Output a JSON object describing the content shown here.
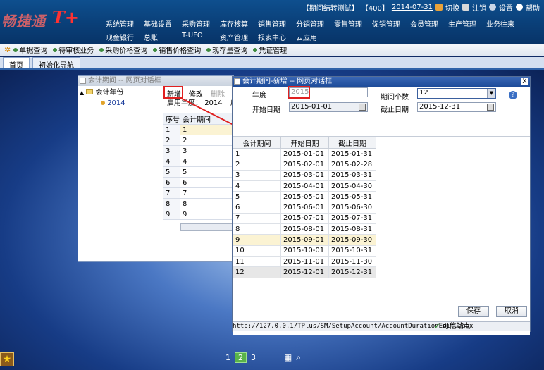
{
  "header": {
    "logo_text": "畅捷通",
    "logo_suffix": "T+",
    "status": {
      "account": "【期间结转测试】",
      "code": "【400】",
      "date": "2014-07-31",
      "switch_label": "切换",
      "logout_label": "注销",
      "settings_label": "设置",
      "help_label": "帮助"
    },
    "menu_row1": [
      "系统管理",
      "基础设置",
      "采购管理",
      "库存核算",
      "销售管理",
      "分销管理",
      "零售管理",
      "促销管理",
      "会员管理",
      "生产管理",
      "业务往来"
    ],
    "menu_row2": [
      "现金银行",
      "总账",
      "T-UFO",
      "资产管理",
      "报表中心",
      "云应用"
    ]
  },
  "quickbar": [
    "单据查询",
    "待审核业务",
    "采购价格查询",
    "销售价格查询",
    "现存量查询",
    "凭证管理"
  ],
  "tabs": [
    "首页",
    "初始化导航"
  ],
  "left_window": {
    "title": "会计期间 -- 网页对话框",
    "tree_root": "会计年份",
    "tree_child": "2014",
    "toolbar": {
      "add": "新增",
      "edit": "修改",
      "delete": "删除"
    },
    "start_year_label": "启用年度：",
    "start_year_value": "2014",
    "start_year_extra": "启",
    "table_headers": [
      "序号",
      "会计期间"
    ],
    "rows": [
      {
        "no": "1",
        "period": "1"
      },
      {
        "no": "2",
        "period": "2"
      },
      {
        "no": "3",
        "period": "3"
      },
      {
        "no": "4",
        "period": "4"
      },
      {
        "no": "5",
        "period": "5"
      },
      {
        "no": "6",
        "period": "6"
      },
      {
        "no": "7",
        "period": "7"
      },
      {
        "no": "8",
        "period": "8"
      },
      {
        "no": "9",
        "period": "9"
      }
    ]
  },
  "dialog": {
    "title": "会计期间-新增 -- 网页对话框",
    "close": "X",
    "year_label": "年度",
    "year_value": "2015",
    "period_count_label": "期间个数",
    "period_count_value": "12",
    "start_label": "开始日期",
    "start_value": "2015-01-01",
    "end_label": "截止日期",
    "end_value": "2015-12-31",
    "help": "?",
    "grid_headers": [
      "会计期间",
      "开始日期",
      "截止日期"
    ],
    "grid_rows": [
      {
        "period": "1",
        "start": "2015-01-01",
        "end": "2015-01-31"
      },
      {
        "period": "2",
        "start": "2015-02-01",
        "end": "2015-02-28"
      },
      {
        "period": "3",
        "start": "2015-03-01",
        "end": "2015-03-31"
      },
      {
        "period": "4",
        "start": "2015-04-01",
        "end": "2015-04-30"
      },
      {
        "period": "5",
        "start": "2015-05-01",
        "end": "2015-05-31"
      },
      {
        "period": "6",
        "start": "2015-06-01",
        "end": "2015-06-30"
      },
      {
        "period": "7",
        "start": "2015-07-01",
        "end": "2015-07-31"
      },
      {
        "period": "8",
        "start": "2015-08-01",
        "end": "2015-08-31"
      },
      {
        "period": "9",
        "start": "2015-09-01",
        "end": "2015-09-30"
      },
      {
        "period": "10",
        "start": "2015-10-01",
        "end": "2015-10-31"
      },
      {
        "period": "11",
        "start": "2015-11-01",
        "end": "2015-11-30"
      },
      {
        "period": "12",
        "start": "2015-12-01",
        "end": "2015-12-31"
      }
    ],
    "save_label": "保存",
    "cancel_label": "取消",
    "status_url": "http://127.0.0.1/TPlus/SM/SetupAccount/AccountDurationEdit.aspx",
    "status_trust": "可信站点"
  },
  "pager": {
    "pages": [
      "1",
      "2",
      "3"
    ],
    "current": "2"
  },
  "colors": {
    "accent": "#1d4b99",
    "highlight": "#e02020",
    "selected_row": "#fbf3d3"
  }
}
